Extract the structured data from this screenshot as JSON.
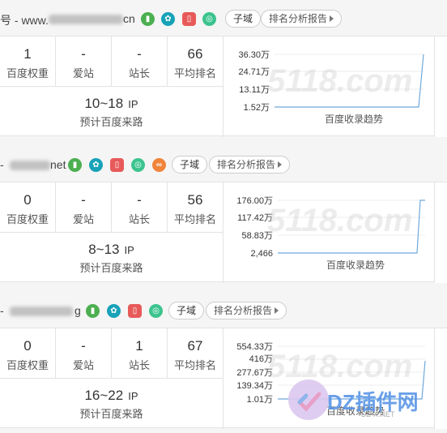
{
  "sites": [
    {
      "title": "号 - www.",
      "title_suffix": "cn",
      "tags": {
        "subdomain": "子域",
        "rank_report": "排名分析报告"
      },
      "metrics": [
        {
          "value": "1",
          "label": "百度权重"
        },
        {
          "value": "-",
          "label": "爱站"
        },
        {
          "value": "-",
          "label": "站长"
        },
        {
          "value": "66",
          "label": "平均排名"
        }
      ],
      "traffic": {
        "value": "10~18",
        "unit": "IP",
        "label": "预计百度来路"
      },
      "chart": {
        "yticks": [
          "36.30万",
          "24.71万",
          "13.11万",
          "1.52万"
        ],
        "caption": "百度收录趋势"
      }
    },
    {
      "title": "-",
      "title_suffix": "net",
      "tags": {
        "subdomain": "子域",
        "rank_report": "排名分析报告"
      },
      "metrics": [
        {
          "value": "0",
          "label": "百度权重"
        },
        {
          "value": "-",
          "label": "爱站"
        },
        {
          "value": "-",
          "label": "站长"
        },
        {
          "value": "56",
          "label": "平均排名"
        }
      ],
      "traffic": {
        "value": "8~13",
        "unit": "IP",
        "label": "预计百度来路"
      },
      "chart": {
        "yticks": [
          "176.00万",
          "117.42万",
          "58.83万",
          "2,466"
        ],
        "caption": "百度收录趋势"
      }
    },
    {
      "title": "-",
      "title_suffix": "g",
      "tags": {
        "subdomain": "子域",
        "rank_report": "排名分析报告"
      },
      "metrics": [
        {
          "value": "0",
          "label": "百度权重"
        },
        {
          "value": "-",
          "label": "爱站"
        },
        {
          "value": "1",
          "label": "站长"
        },
        {
          "value": "67",
          "label": "平均排名"
        }
      ],
      "traffic": {
        "value": "16~22",
        "unit": "IP",
        "label": "预计百度来路"
      },
      "chart": {
        "yticks": [
          "554.33万",
          "416万",
          "277.67万",
          "139.34万",
          "1.01万"
        ],
        "caption": "百度收录趋势"
      }
    }
  ],
  "watermarks": {
    "site": "5118.com",
    "dz": "DZ插件网",
    "dz_sub": "DZ-X.NET"
  }
}
